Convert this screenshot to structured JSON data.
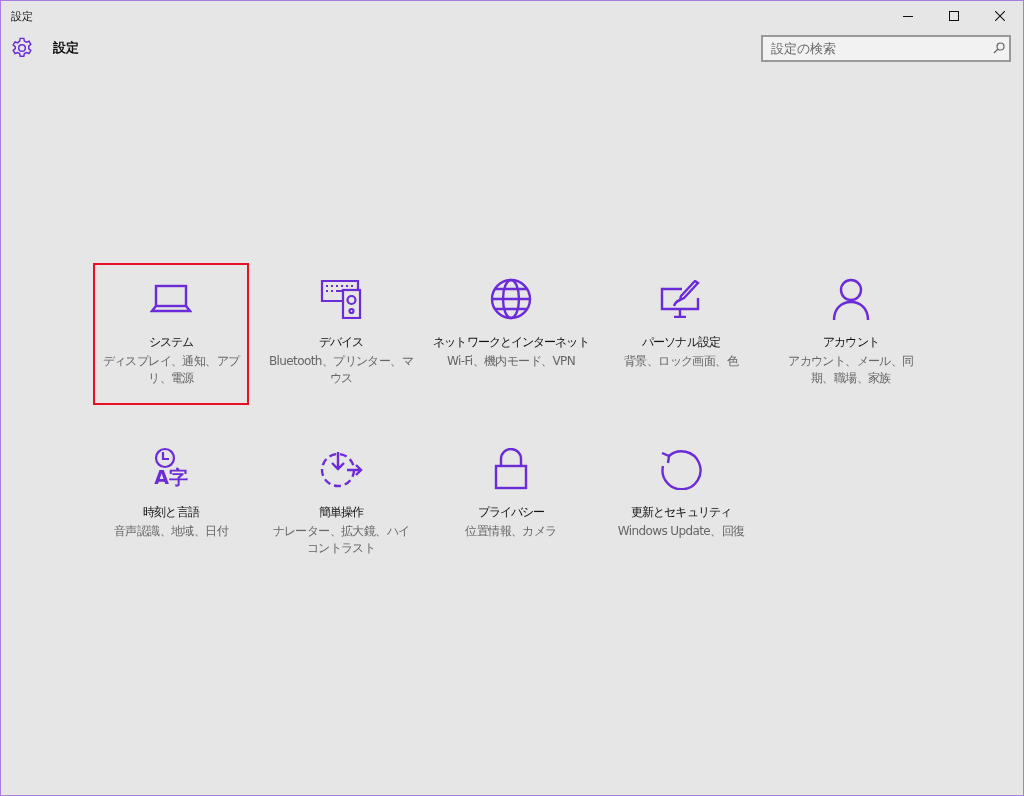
{
  "window": {
    "title": "設定"
  },
  "header": {
    "title": "設定",
    "search": {
      "placeholder": "設定の検索"
    }
  },
  "tiles": [
    {
      "kind": "system",
      "label": "システム",
      "description": "ディスプレイ、通知、アプリ、電源",
      "selected": true
    },
    {
      "kind": "devices",
      "label": "デバイス",
      "description": "Bluetooth、プリンター、マウス",
      "selected": false
    },
    {
      "kind": "network",
      "label": "ネットワークとインターネット",
      "description": "Wi-Fi、機内モード、VPN",
      "selected": false
    },
    {
      "kind": "personalization",
      "label": "パーソナル設定",
      "description": "背景、ロック画面、色",
      "selected": false
    },
    {
      "kind": "accounts",
      "label": "アカウント",
      "description": "アカウント、メール、同期、職場、家族",
      "selected": false
    },
    {
      "kind": "time",
      "label": "時刻と言語",
      "description": "音声認識、地域、日付",
      "selected": false,
      "icon_glyph": "A字"
    },
    {
      "kind": "ease",
      "label": "簡単操作",
      "description": "ナレーター、拡大鏡、ハイコントラスト",
      "selected": false
    },
    {
      "kind": "privacy",
      "label": "プライバシー",
      "description": "位置情報、カメラ",
      "selected": false
    },
    {
      "kind": "update",
      "label": "更新とセキュリティ",
      "description": "Windows Update、回復",
      "selected": false
    }
  ]
}
